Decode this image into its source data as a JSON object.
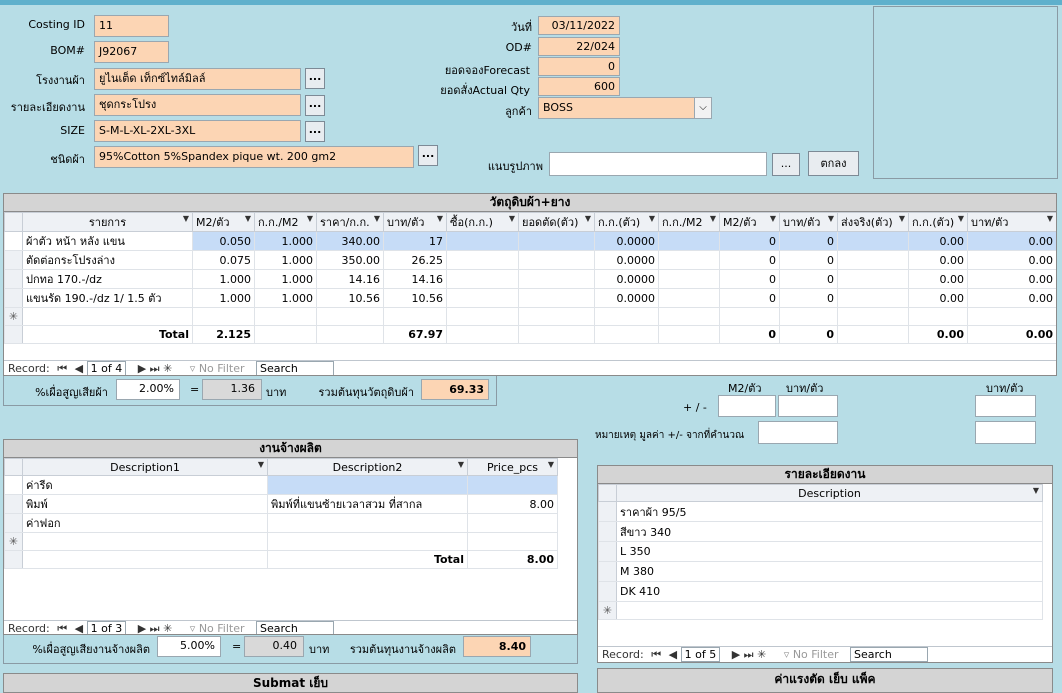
{
  "header": {
    "costing_id_label": "Costing ID",
    "costing_id": "11",
    "bom_label": "BOM#",
    "bom": "J92067",
    "factory_label": "โรงงานผ้า",
    "factory": "ยูไนเต็ด เท็กซ์ไทล์มิลล์",
    "detail_label": "รายละเอียดงาน",
    "detail": "ชุดกระโปรง",
    "size_label": "SIZE",
    "size": "S-M-L-XL-2XL-3XL",
    "fabric_label": "ชนิดผ้า",
    "fabric": "95%Cotton 5%Spandex pique wt. 200 gm2",
    "date_label": "วันที่",
    "date": "03/11/2022",
    "od_label": "OD#",
    "od": "22/024",
    "forecast_label": "ยอดจองForecast",
    "forecast": "0",
    "actual_label": "ยอดสั่งActual Qty",
    "actual": "600",
    "customer_label": "ลูกค้า",
    "customer": "BOSS",
    "attach_label": "แนบรูปภาพ",
    "attach_value": "",
    "dots": "...",
    "ok_button": "ตกลง"
  },
  "materials": {
    "title": "วัตถุดิบผ้า+ยาง",
    "columns": [
      "รายการ",
      "M2/ตัว",
      "ก.ก./M2",
      "ราคา/ก.ก.",
      "บาท/ตัว",
      "ซื้อ(ก.ก.)",
      "ยอดตัด(ตัว)",
      "ก.ก.(ตัว)",
      "ก.ก./M2",
      "M2/ตัว",
      "บาท/ตัว",
      "ส่งจริง(ตัว)",
      "ก.ก.(ตัว)",
      "บาท/ตัว"
    ],
    "rows": [
      [
        "ผ้าตัว หน้า หลัง แขน",
        "0.050",
        "1.000",
        "340.00",
        "17",
        "",
        "",
        "0.0000",
        "",
        "0",
        "0",
        "",
        "0.00",
        "0.00"
      ],
      [
        "ตัดต่อกระโปรงล่าง",
        "0.075",
        "1.000",
        "350.00",
        "26.25",
        "",
        "",
        "0.0000",
        "",
        "0",
        "0",
        "",
        "0.00",
        "0.00"
      ],
      [
        "ปกทอ 170.-/dz",
        "1.000",
        "1.000",
        "14.16",
        "14.16",
        "",
        "",
        "0.0000",
        "",
        "0",
        "0",
        "",
        "0.00",
        "0.00"
      ],
      [
        "แขนรัด 190.-/dz  1/ 1.5  ตัว",
        "1.000",
        "1.000",
        "10.56",
        "10.56",
        "",
        "",
        "0.0000",
        "",
        "0",
        "0",
        "",
        "0.00",
        "0.00"
      ]
    ],
    "total_label": "Total",
    "totals": [
      "2.125",
      "",
      "",
      "67.97",
      "",
      "",
      "",
      "",
      "0",
      "0",
      "",
      "0.00",
      "0.00"
    ],
    "nav": {
      "record": "Record:",
      "position": "1 of 4",
      "no_filter": "No Filter",
      "search": "Search"
    },
    "loss_label": "%เผื่อสูญเสียผ้า",
    "loss_pct": "2.00%",
    "eq": "=",
    "loss_value": "1.36",
    "baht": "บาท",
    "sum_label": "รวมต้นทุนวัตถุดิบผ้า",
    "sum_value": "69.33"
  },
  "adjust": {
    "m2_label": "M2/ตัว",
    "baht_label": "บาท/ตัว",
    "baht_label2": "บาท/ตัว",
    "plus_minus": "+ / -",
    "note_label": "หมายเหตุ  มูลค่า +/- จากที่คำนวณ"
  },
  "labor": {
    "title": "งานจ้างผลิต",
    "columns": [
      "Description1",
      "Description2",
      "Price_pcs"
    ],
    "rows": [
      [
        "ค่ารีด",
        "",
        ""
      ],
      [
        "พิมพ์",
        "พิมพ์ที่แขนซ้ายเวลาสวม ที่สากล",
        "8.00"
      ],
      [
        "ค่าฟอก",
        "",
        ""
      ]
    ],
    "total_label": "Total",
    "total": "8.00",
    "nav": {
      "record": "Record:",
      "position": "1 of 3",
      "no_filter": "No Filter",
      "search": "Search"
    },
    "loss_label": "%เผื่อสูญเสียงานจ้างผลิต",
    "loss_pct": "5.00%",
    "eq": "=",
    "loss_value": "0.40",
    "baht": "บาท",
    "sum_label": "รวมต้นทุนงานจ้างผลิต",
    "sum_value": "8.40"
  },
  "details": {
    "title": "รายละเอียดงาน",
    "column": "Description",
    "rows": [
      "ราคาผ้า 95/5",
      "สีขาว 340",
      "L 350",
      "M 380",
      "DK 410"
    ],
    "nav": {
      "record": "Record:",
      "position": "1 of 5",
      "no_filter": "No Filter",
      "search": "Search"
    }
  },
  "bottom": {
    "submat_title": "Submat เย็บ",
    "sewing_title": "ค่าแรงตัด เย็บ แพ็ค"
  }
}
